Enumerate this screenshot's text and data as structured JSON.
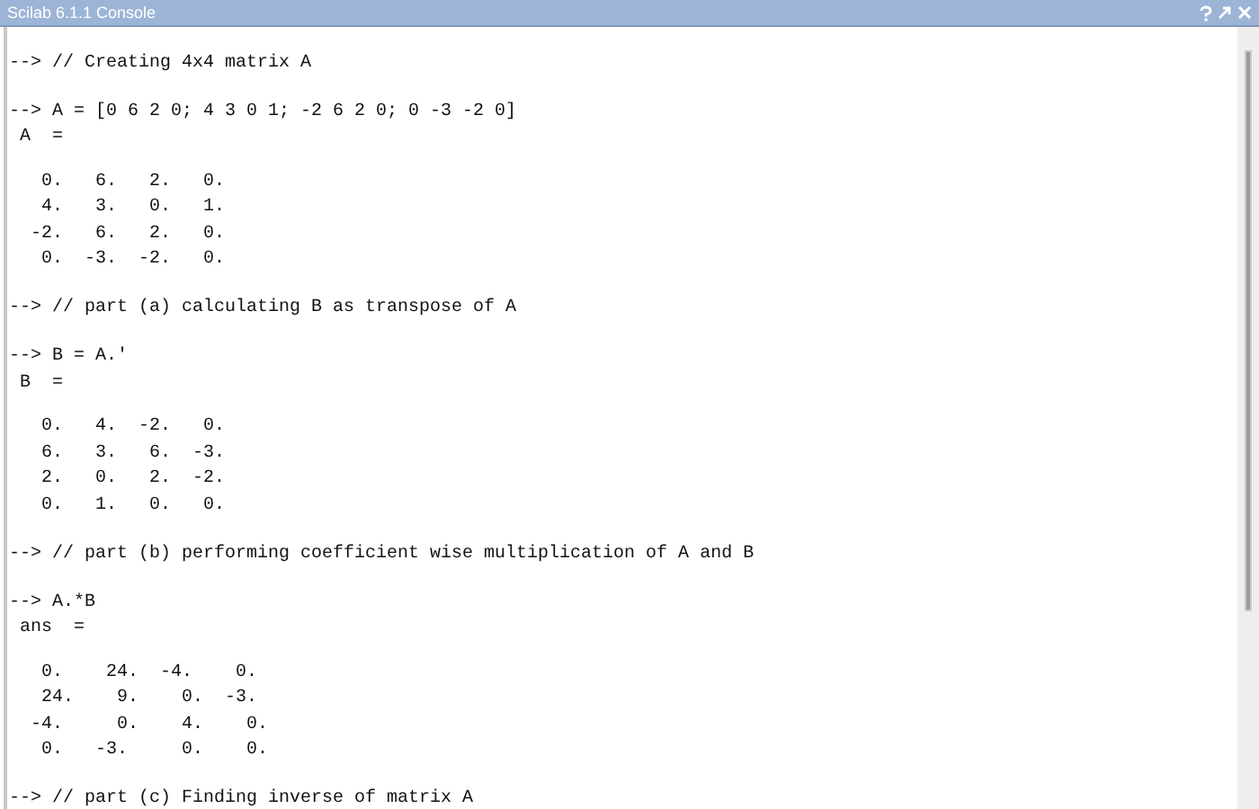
{
  "window": {
    "title": "Scilab 6.1.1 Console"
  },
  "console": [
    {
      "kind": "command",
      "text": "--> // Creating 4x4 matrix A"
    },
    {
      "kind": "command",
      "text": "--> A = [0 6 2 0; 4 3 0 1; -2 6 2 0; 0 -3 -2 0]"
    },
    {
      "kind": "result",
      "header": "A  =",
      "rows": [
        "   0.   6.   2.   0.",
        "   4.   3.   0.   1.",
        "  -2.   6.   2.   0.",
        "   0.  -3.  -2.   0."
      ]
    },
    {
      "kind": "command",
      "text": "--> // part (a) calculating B as transpose of A"
    },
    {
      "kind": "command",
      "text": "--> B = A.'"
    },
    {
      "kind": "result",
      "header": "B  =",
      "rows": [
        "   0.   4.  -2.   0.",
        "   6.   3.   6.  -3.",
        "   2.   0.   2.  -2.",
        "   0.   1.   0.   0."
      ]
    },
    {
      "kind": "command",
      "text": "--> // part (b) performing coefficient wise multiplication of A and B"
    },
    {
      "kind": "command",
      "text": "--> A.*B"
    },
    {
      "kind": "result",
      "header": "ans  =",
      "rows": [
        "   0.    24.  -4.    0.",
        "   24.    9.    0.  -3.",
        "  -4.     0.    4.    0.",
        "   0.   -3.     0.    0."
      ]
    },
    {
      "kind": "command",
      "text": "--> // part (c) Finding inverse of matrix A"
    }
  ]
}
